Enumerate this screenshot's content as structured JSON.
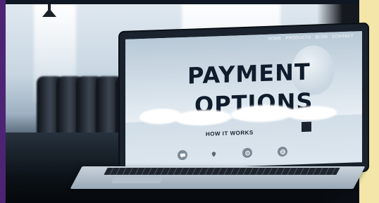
{
  "screen": {
    "nav": [
      "HOME",
      "PRODUCTS",
      "BLOG",
      "CONTACT"
    ],
    "title_line1": "PAYMENT",
    "title_line2": "OPTIONS",
    "subtitle": "HOW IT WORKS",
    "features": [
      "chat-icon",
      "location-icon",
      "gear-icon",
      "globe-icon"
    ]
  },
  "colors": {
    "left_border": "#4d2474",
    "right_border": "#f3e6a8",
    "title_text": "#0f1c2c"
  }
}
